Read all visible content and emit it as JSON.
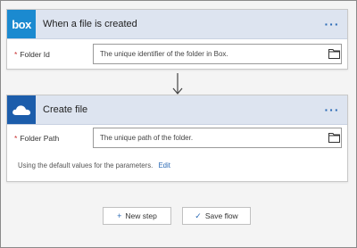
{
  "trigger": {
    "icon": "box-logo",
    "logo_text": "box",
    "title": "When a file is created",
    "field_label": "Folder Id",
    "field_placeholder": "The unique identifier of the folder in Box."
  },
  "action": {
    "icon": "onedrive-logo",
    "title": "Create file",
    "field_label": "Folder Path",
    "field_placeholder": "The unique path of the folder.",
    "defaults_text": "Using the default values for the parameters.",
    "edit_label": "Edit"
  },
  "required_marker": "*",
  "more_glyph": "···",
  "buttons": {
    "new_step": "New step",
    "save_flow": "Save flow"
  },
  "colors": {
    "header_bg": "#dde4f0",
    "box_brand": "#1b8ad0",
    "onedrive_brand": "#1c5dab",
    "link": "#2b6ab5"
  }
}
